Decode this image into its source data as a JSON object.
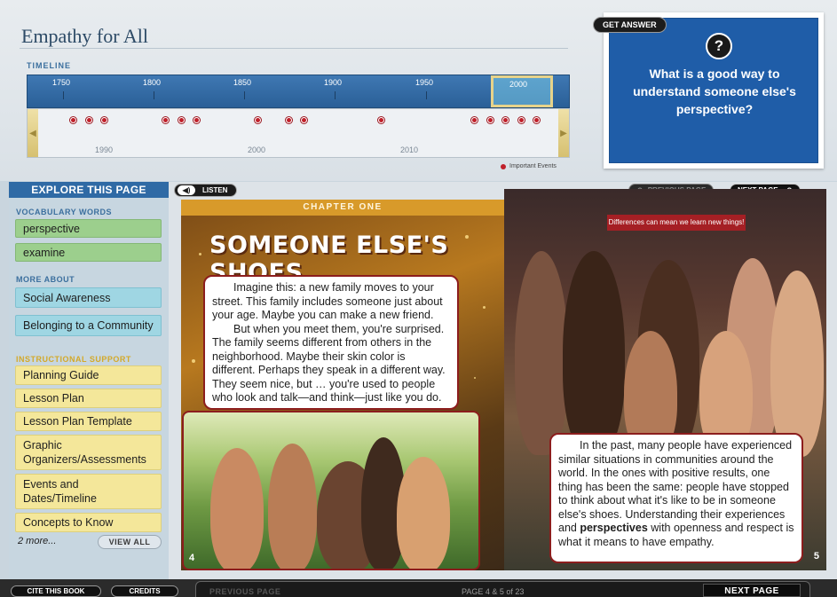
{
  "header": {
    "title": "Empathy for All"
  },
  "timeline": {
    "label": "TIMELINE",
    "top_years": [
      "1750",
      "1800",
      "1850",
      "1900",
      "1950",
      "2000"
    ],
    "window_year": "2000",
    "bottom_years": [
      "1990",
      "2000",
      "2010"
    ],
    "legend": "Important Events"
  },
  "answer": {
    "badge": "GET ANSWER",
    "icon_glyph": "?",
    "question": "What is a good way to understand someone else's perspective?"
  },
  "sidebar": {
    "title": "EXPLORE THIS PAGE",
    "vocab_label": "VOCABULARY WORDS",
    "vocab": [
      {
        "label": "perspective"
      },
      {
        "label": "examine"
      }
    ],
    "more_about_label": "MORE ABOUT",
    "more_about": [
      {
        "label": "Social Awareness"
      },
      {
        "label": "Belonging to a Community"
      }
    ],
    "instructional_label": "INSTRUCTIONAL SUPPORT",
    "instructional": [
      {
        "label": "Planning Guide"
      },
      {
        "label": "Lesson Plan"
      },
      {
        "label": "Lesson Plan Template"
      },
      {
        "label": "Graphic Organizers/Assessments"
      },
      {
        "label": "Events and Dates/Timeline"
      },
      {
        "label": "Concepts to Know"
      }
    ],
    "more_link": "2 more...",
    "view_all": "VIEW ALL"
  },
  "viewer": {
    "listen": "LISTEN",
    "prev_top": "PREVIOUS PAGE",
    "next_top": "NEXT PAGE",
    "chapter": "CHAPTER ONE",
    "chapter_title": "SOMEONE ELSE'S SHOES",
    "para1": "Imagine this: a new family moves to your street. This family includes someone just about your age. Maybe you can make a new friend.",
    "para2": "But when you meet them, you're surprised. The family seems different from others in the neighborhood. Maybe their skin color is different. Perhaps they speak in a different way. They seem nice, but … you're used to people who look and talk—and think—just like you do.",
    "caption": "Differences can mean we learn new things!",
    "right_para_pre": "In the past, many people have experienced similar situations in communities around the world. In the ones with positive results, one thing has been the same: people have stopped to think about what it's like to be in someone else's shoes. Understanding their experiences and",
    "right_para_bold": "perspectives",
    "right_para_post": "with openness and respect is what it means to have empathy.",
    "page_left_num": "4",
    "page_right_num": "5"
  },
  "footer": {
    "cite": "CITE THIS BOOK",
    "credits": "CREDITS",
    "prev": "PREVIOUS PAGE",
    "page_count": "PAGE 4 & 5 of 23",
    "next": "NEXT PAGE"
  },
  "colors": {
    "accent_blue": "#2f6aa5",
    "vocab_green": "#9ccf8d",
    "more_about_cyan": "#9fd6e3",
    "support_yellow": "#f4e79a",
    "event_red": "#c0202a",
    "border_maroon": "#8c1d1d"
  }
}
